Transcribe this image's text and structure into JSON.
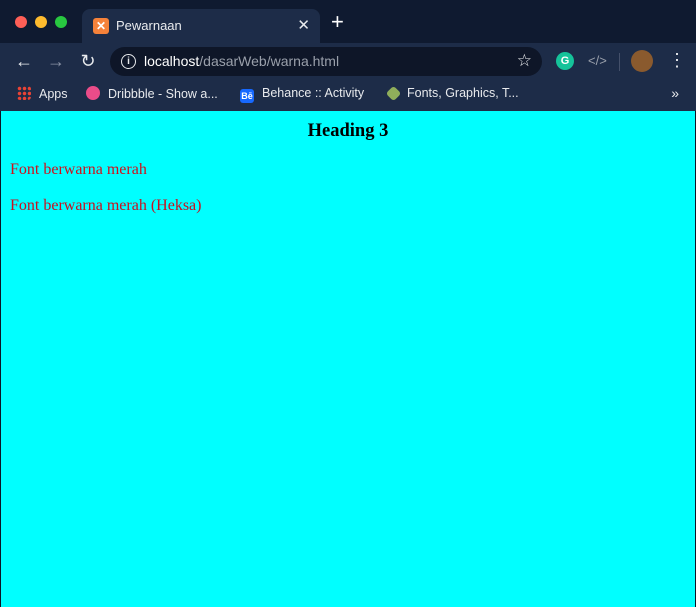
{
  "browser": {
    "tab": {
      "title": "Pewarnaan",
      "favicon": "xampp-icon"
    },
    "new_tab": "+",
    "url": {
      "host": "localhost",
      "path": "/dasarWeb/warna.html"
    },
    "bookmarks": [
      {
        "label": "Apps",
        "icon": "apps-grid-icon"
      },
      {
        "label": "Dribbble - Show a...",
        "icon": "dribbble-icon"
      },
      {
        "label": "Behance :: Activity",
        "icon": "behance-icon"
      },
      {
        "label": "Fonts, Graphics, T...",
        "icon": "tag-icon"
      }
    ],
    "bookmarks_overflow": "»"
  },
  "page": {
    "background": "#00ffff",
    "heading": "Heading 3",
    "paragraphs": [
      {
        "text": "Font berwarna merah",
        "color": "#d0101a"
      },
      {
        "text": "Font berwarna merah (Heksa)",
        "color": "#c8101f"
      }
    ]
  }
}
